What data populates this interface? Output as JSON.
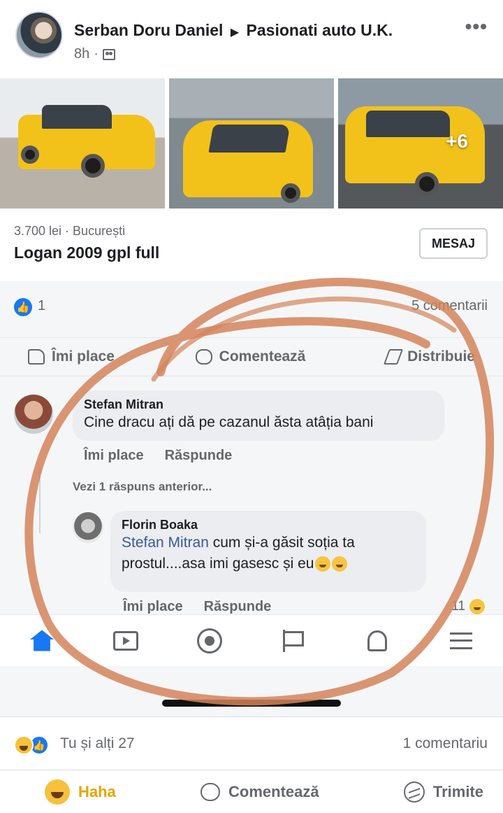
{
  "post": {
    "author": "Serban Doru Daniel",
    "separator": "▶",
    "group": "Pasionati auto  U.K.",
    "time": "8h",
    "dot": "·",
    "more": "•••"
  },
  "screenshot": {
    "photos_more": "+6",
    "listing": {
      "price": "3.700 lei · București",
      "title": "Logan 2009 gpl full",
      "message_button": "MESAJ"
    },
    "reactions": {
      "count": "1",
      "comments": "5 comentarii"
    },
    "actions": {
      "like": "Îmi place",
      "comment": "Comentează",
      "share": "Distribuie"
    },
    "comment1": {
      "name": "Stefan Mitran",
      "text": "Cine dracu ați dă pe cazanul ăsta atâția bani",
      "like": "Îmi place",
      "reply": "Răspunde"
    },
    "view_previous": "Vezi 1 răspuns anterior...",
    "comment2": {
      "name": "Florin Boaka",
      "mention": "Stefan Mitran",
      "text_line1": " cum și-a găsit soția ta",
      "text_line2": "prostul....asa imi gasesc și eu",
      "like": "Îmi place",
      "reply": "Răspunde",
      "reaction_count": "11"
    },
    "tabbar": [
      "home-icon",
      "video-icon",
      "groups-icon",
      "pages-icon",
      "bell-icon",
      "menu-icon"
    ]
  },
  "footer": {
    "reactions_text": "Tu și alți 27",
    "comments_text": "1 comentariu",
    "haha": "Haha",
    "comment": "Comentează",
    "send": "Trimite"
  },
  "colors": {
    "accent": "#1877f2",
    "haha": "#e7a400",
    "marker": "#d3845a",
    "taxi_yellow": "#f2c21b"
  }
}
